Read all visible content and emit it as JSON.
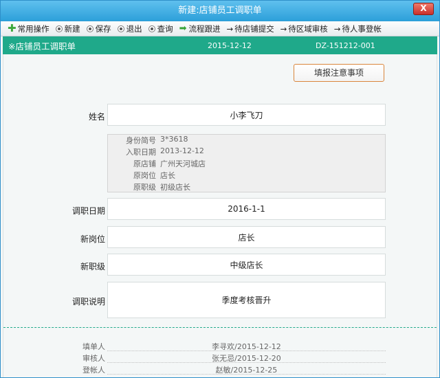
{
  "window": {
    "title": "新建:店铺员工调职单",
    "close_label": "X"
  },
  "toolbar": {
    "common_ops": "常用操作",
    "new": "新建",
    "save": "保存",
    "exit": "退出",
    "query": "查询",
    "flow_track": "流程跟进",
    "to_store_submit": "待店铺提交",
    "to_region_review": "待区域审核",
    "to_hr_register": "待人事登帐"
  },
  "header": {
    "title": "※店铺员工调职单",
    "date": "2015-12-12",
    "doc_no": "DZ-151212-001"
  },
  "notice_button": "填报注意事项",
  "form": {
    "name_label": "姓名",
    "name_value": "小李飞刀",
    "info": [
      {
        "key": "身份简号",
        "value": "3*3618"
      },
      {
        "key": "入职日期",
        "value": "2013-12-12"
      },
      {
        "key": "原店铺",
        "value": "广州天河城店"
      },
      {
        "key": "原岗位",
        "value": "店长"
      },
      {
        "key": "原职级",
        "value": "初级店长"
      }
    ],
    "transfer_date_label": "调职日期",
    "transfer_date_value": "2016-1-1",
    "new_post_label": "新岗位",
    "new_post_value": "店长",
    "new_level_label": "新职级",
    "new_level_value": "中级店长",
    "note_label": "调职说明",
    "note_value": "季度考核晋升"
  },
  "footer": [
    {
      "key": "填单人",
      "value": "李寻欢/2015-12-12"
    },
    {
      "key": "审核人",
      "value": "张无忌/2015-12-20"
    },
    {
      "key": "登帐人",
      "value": "赵敏/2015-12-25"
    }
  ]
}
